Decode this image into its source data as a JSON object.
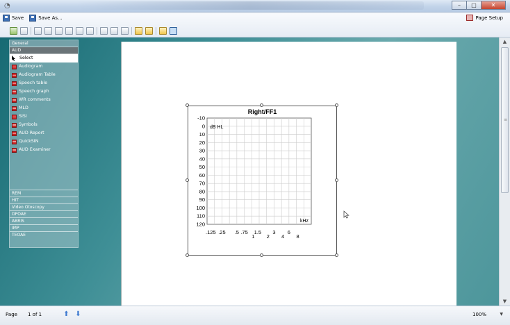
{
  "toolbar": {
    "save_label": "Save",
    "save_as_label": "Save As...",
    "page_setup_label": "Page Setup"
  },
  "sidebar": {
    "header": "General",
    "selected_group": "AUD",
    "items": [
      {
        "label": "Select",
        "icon": "cursor-icon"
      },
      {
        "label": "Audiogram"
      },
      {
        "label": "Audiogram Table"
      },
      {
        "label": "Speech table"
      },
      {
        "label": "Speech graph"
      },
      {
        "label": "WR comments"
      },
      {
        "label": "MLD"
      },
      {
        "label": "SISI"
      },
      {
        "label": "Symbols"
      },
      {
        "label": "AUD Report"
      },
      {
        "label": "QuickSIN"
      },
      {
        "label": "AUD Examiner"
      }
    ],
    "categories": [
      "REM",
      "HIT",
      "Video Otoscopy",
      "DPOAE",
      "ABRIS",
      "IMP",
      "TEOAE"
    ]
  },
  "chart": {
    "title": "Right/FF1",
    "y_unit": "dB HL",
    "x_unit": "kHz",
    "y_ticks": [
      "-10",
      "0",
      "10",
      "20",
      "30",
      "40",
      "50",
      "60",
      "70",
      "80",
      "90",
      "100",
      "110",
      "120"
    ],
    "x_ticks_top": [
      ".125",
      ".25",
      ".5",
      ".75",
      "1.5",
      "3",
      "6"
    ],
    "x_ticks_bottom": [
      "1",
      "2",
      "4",
      "8"
    ]
  },
  "statusbar": {
    "page_label": "Page",
    "page_of": "1  of  1",
    "zoom": "100%"
  }
}
